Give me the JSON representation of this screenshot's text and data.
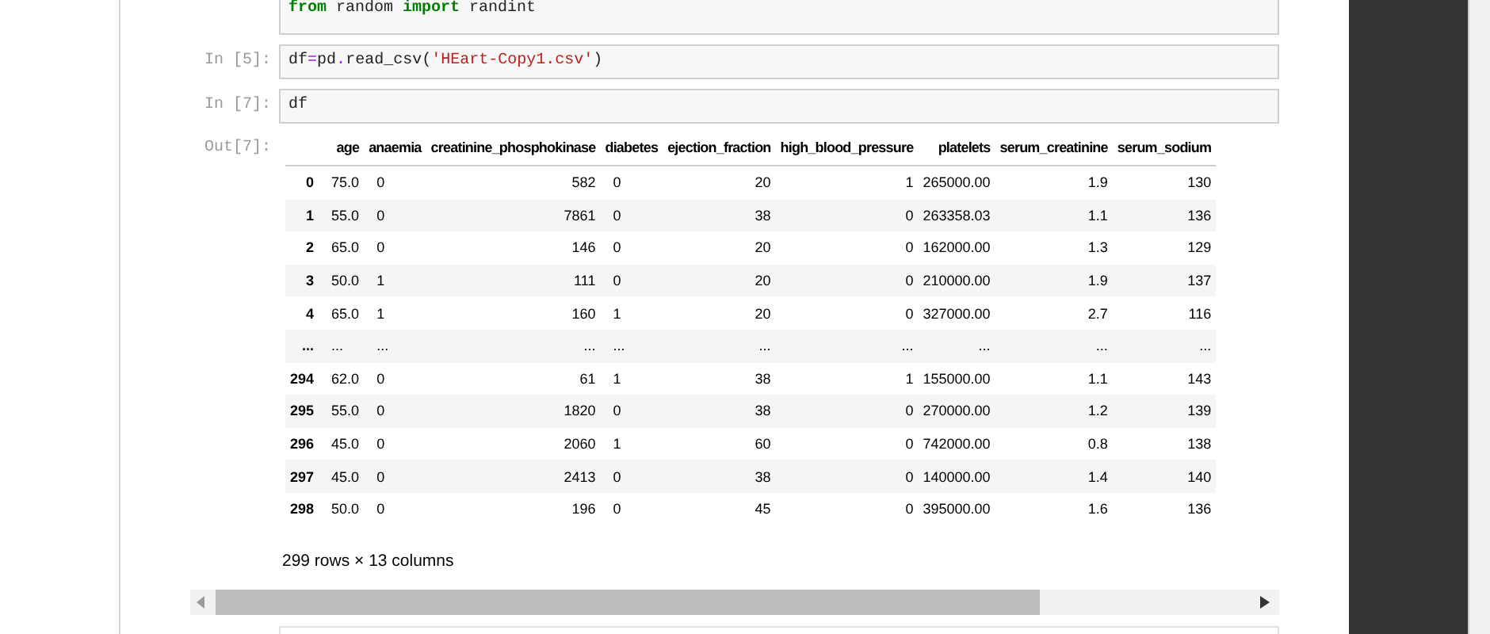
{
  "cells": [
    {
      "lines": [
        [
          {
            "t": "from",
            "kind": "keyword"
          },
          {
            "t": " random ",
            "kind": "plain"
          },
          {
            "t": "import",
            "kind": "keyword"
          },
          {
            "t": " randint",
            "kind": "plain"
          }
        ]
      ]
    },
    {
      "prompt": "In [5]:",
      "lines": [
        [
          {
            "t": "df",
            "kind": "plain"
          },
          {
            "t": "=",
            "kind": "operator"
          },
          {
            "t": "pd",
            "kind": "plain"
          },
          {
            "t": ".",
            "kind": "operator"
          },
          {
            "t": "read_csv(",
            "kind": "plain"
          },
          {
            "t": "'HEart-Copy1.csv'",
            "kind": "string"
          },
          {
            "t": ")",
            "kind": "plain"
          }
        ]
      ]
    },
    {
      "prompt": "In [7]:",
      "lines": [
        [
          {
            "t": "df",
            "kind": "plain"
          }
        ]
      ]
    }
  ],
  "output": {
    "prompt": "Out[7]:",
    "table": {
      "columns": [
        "",
        "age",
        "anaemia",
        "creatinine_phosphokinase",
        "diabetes",
        "ejection_fraction",
        "high_blood_pressure",
        "platelets",
        "serum_creatinine",
        "serum_sodium"
      ],
      "rows": [
        [
          "0",
          "75.0",
          "0",
          "582",
          "0",
          "20",
          "1",
          "265000.00",
          "1.9",
          "130"
        ],
        [
          "1",
          "55.0",
          "0",
          "7861",
          "0",
          "38",
          "0",
          "263358.03",
          "1.1",
          "136"
        ],
        [
          "2",
          "65.0",
          "0",
          "146",
          "0",
          "20",
          "0",
          "162000.00",
          "1.3",
          "129"
        ],
        [
          "3",
          "50.0",
          "1",
          "111",
          "0",
          "20",
          "0",
          "210000.00",
          "1.9",
          "137"
        ],
        [
          "4",
          "65.0",
          "1",
          "160",
          "1",
          "20",
          "0",
          "327000.00",
          "2.7",
          "116"
        ],
        [
          "...",
          "...",
          "...",
          "...",
          "...",
          "...",
          "...",
          "...",
          "...",
          "..."
        ],
        [
          "294",
          "62.0",
          "0",
          "61",
          "1",
          "38",
          "1",
          "155000.00",
          "1.1",
          "143"
        ],
        [
          "295",
          "55.0",
          "0",
          "1820",
          "0",
          "38",
          "0",
          "270000.00",
          "1.2",
          "139"
        ],
        [
          "296",
          "45.0",
          "0",
          "2060",
          "1",
          "60",
          "0",
          "742000.00",
          "0.8",
          "138"
        ],
        [
          "297",
          "45.0",
          "0",
          "2413",
          "0",
          "38",
          "0",
          "140000.00",
          "1.4",
          "140"
        ],
        [
          "298",
          "50.0",
          "0",
          "196",
          "0",
          "45",
          "0",
          "395000.00",
          "1.6",
          "136"
        ]
      ]
    },
    "summary": "299 rows × 13 columns"
  }
}
